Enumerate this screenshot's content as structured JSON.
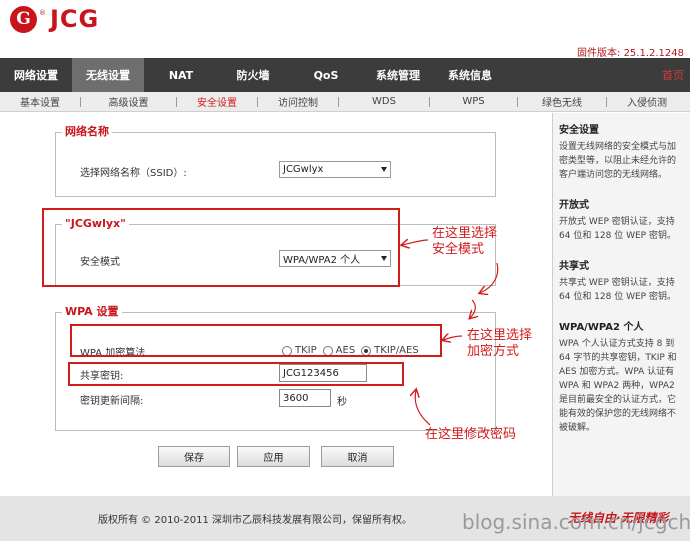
{
  "header": {
    "logo_mark": "G",
    "logo_reg": "®",
    "logo_text": "JCG",
    "firmware_version": "固件版本: 25.1.2.1248"
  },
  "main_nav": {
    "items": [
      "网络设置",
      "无线设置",
      "NAT",
      "防火墙",
      "QoS",
      "系统管理",
      "系统信息"
    ],
    "active": "无线设置",
    "home_label": "首页"
  },
  "sub_nav": {
    "items": [
      "基本设置",
      "高级设置",
      "安全设置",
      "访问控制",
      "WDS",
      "WPS",
      "绿色无线",
      "入侵侦测"
    ],
    "active": "安全设置"
  },
  "network_name_section": {
    "legend": "网络名称",
    "ssid_label": "选择网络名称（SSID）:",
    "ssid_value": "JCGwlyx"
  },
  "ssid_section": {
    "legend": "\"JCGwlyx\"",
    "security_mode_label": "安全模式",
    "security_mode_value": "WPA/WPA2 个人"
  },
  "wpa_section": {
    "legend": "WPA 设置",
    "cipher_label": "WPA 加密算法",
    "cipher_options": [
      "TKIP",
      "AES",
      "TKIP/AES"
    ],
    "cipher_selected": "TKIP/AES",
    "psk_label": "共享密钥:",
    "psk_value": "JCG123456",
    "rekey_label": "密钥更新间隔:",
    "rekey_value": "3600",
    "rekey_unit": "秒"
  },
  "buttons": {
    "save": "保存",
    "apply": "应用",
    "cancel": "取消"
  },
  "annotations": {
    "mode_note_line1": "在这里选择",
    "mode_note_line2": "安全模式",
    "cipher_note_line1": "在这里选择",
    "cipher_note_line2": "加密方式",
    "key_note": "在这里修改密码"
  },
  "help": {
    "security_title": "安全设置",
    "security_body": "设置无线网络的安全模式与加密类型等，以阻止未经允许的客户端访问您的无线网络。",
    "open_title": "开放式",
    "open_body": "开放式 WEP 密钥认证，支持 64 位和 128 位 WEP 密钥。",
    "shared_title": "共享式",
    "shared_body": "共享式 WEP 密钥认证，支持 64 位和 128 位 WEP 密钥。",
    "wpa_title": "WPA/WPA2 个人",
    "wpa_body": "WPA 个人认证方式支持 8 到 64 字节的共享密钥，TKIP 和 AES 加密方式。WPA 认证有 WPA 和 WPA2 两种，WPA2 是目前最安全的认证方式，它能有效的保护您的无线网络不被破解。"
  },
  "footer": {
    "copyright": "版权所有 © 2010-2011 深圳市乙辰科技发展有限公司，保留所有权。",
    "slogan": "无线自由·无限精彩",
    "watermark": "blog.sina.com.cn/jcgch"
  },
  "colors": {
    "brand_red": "#c8151b",
    "nav_bg": "#3c3c3c",
    "annotation_red": "#d11c1c"
  }
}
